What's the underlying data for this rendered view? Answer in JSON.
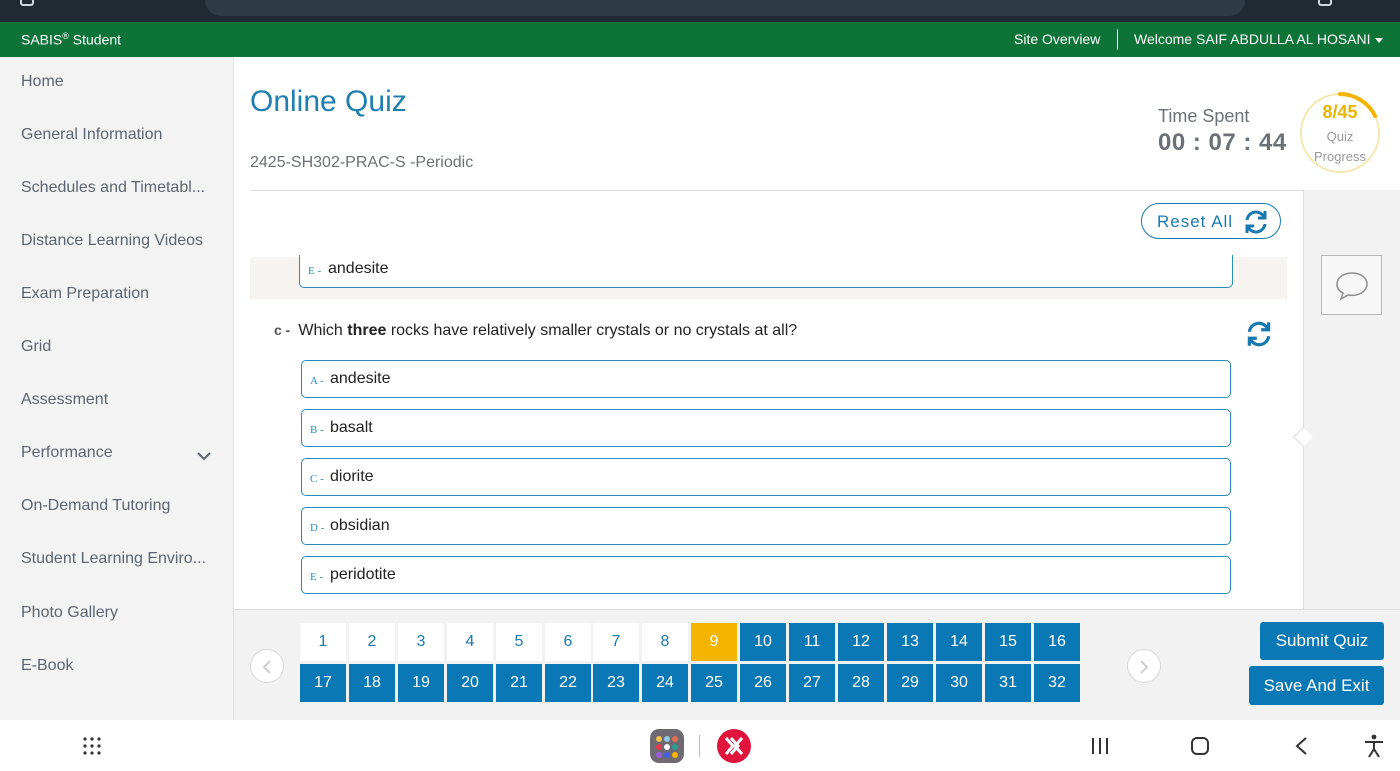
{
  "header": {
    "brand": "SABIS",
    "brand_mark": "®",
    "brand_suffix": " Student",
    "site_overview": "Site Overview",
    "welcome": "Welcome SAIF ABDULLA AL HOSANI"
  },
  "sidebar": {
    "items": [
      {
        "label": "Home"
      },
      {
        "label": "General Information"
      },
      {
        "label": "Schedules and Timetabl..."
      },
      {
        "label": "Distance Learning Videos"
      },
      {
        "label": "Exam Preparation"
      },
      {
        "label": "Grid"
      },
      {
        "label": "Assessment"
      },
      {
        "label": "Performance"
      },
      {
        "label": "On-Demand Tutoring"
      },
      {
        "label": "Student Learning Enviro..."
      },
      {
        "label": "Photo Gallery"
      },
      {
        "label": "E-Book"
      }
    ]
  },
  "quiz": {
    "title": "Online Quiz",
    "code": "2425-SH302-PRAC-S -Periodic",
    "time_label": "Time Spent",
    "time_value": "00 : 07 : 44",
    "progress_value": "8/45",
    "progress_fraction": 0.178,
    "progress_label_1": "Quiz",
    "progress_label_2": "Progress",
    "reset_label": "Reset All",
    "previous_option": {
      "letter": "E -",
      "text": "andesite"
    },
    "question": {
      "label": "c -",
      "text_before": "Which ",
      "text_bold": "three",
      "text_after": " rocks have relatively smaller crystals or no crystals at all?"
    },
    "options": [
      {
        "letter": "A -",
        "text": "andesite"
      },
      {
        "letter": "B -",
        "text": "basalt"
      },
      {
        "letter": "C -",
        "text": "diorite"
      },
      {
        "letter": "D -",
        "text": "obsidian"
      },
      {
        "letter": "E -",
        "text": "peridotite"
      }
    ]
  },
  "navigator": {
    "row1": [
      "1",
      "2",
      "3",
      "4",
      "5",
      "6",
      "7",
      "8",
      "9",
      "10",
      "11",
      "12",
      "13",
      "14",
      "15",
      "16"
    ],
    "row2": [
      "17",
      "18",
      "19",
      "20",
      "21",
      "22",
      "23",
      "24",
      "25",
      "26",
      "27",
      "28",
      "29",
      "30",
      "31",
      "32"
    ],
    "current": "9",
    "unanswered": [
      "1",
      "2",
      "3",
      "4",
      "5",
      "6",
      "7",
      "8"
    ]
  },
  "actions": {
    "submit": "Submit Quiz",
    "save_exit": "Save And Exit"
  },
  "colors": {
    "header_green": "#0d7337",
    "accent_blue": "#0a78b4",
    "current_yellow": "#f5b400",
    "title_blue": "#1f7fb0"
  }
}
